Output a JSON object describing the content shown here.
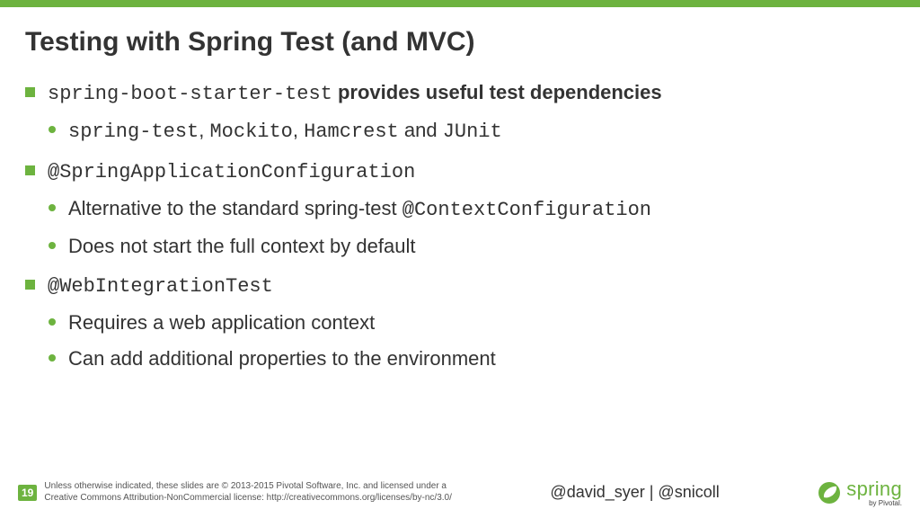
{
  "title": "Testing with Spring Test (and MVC)",
  "bullets": [
    {
      "line_parts": [
        {
          "text": "spring-boot-starter-test",
          "mono": true,
          "bold": false
        },
        {
          "text": " provides useful test dependencies",
          "mono": false,
          "bold": true
        }
      ],
      "subs": [
        {
          "parts": [
            {
              "text": "spring-test",
              "mono": true
            },
            {
              "text": ", ",
              "mono": false
            },
            {
              "text": "Mockito",
              "mono": true
            },
            {
              "text": ", ",
              "mono": false
            },
            {
              "text": "Hamcrest",
              "mono": true
            },
            {
              "text": " and ",
              "mono": false
            },
            {
              "text": "JUnit",
              "mono": true
            }
          ]
        }
      ]
    },
    {
      "line_parts": [
        {
          "text": "@SpringApplicationConfiguration",
          "mono": true,
          "bold": false
        }
      ],
      "subs": [
        {
          "parts": [
            {
              "text": "Alternative to the standard spring-test ",
              "mono": false
            },
            {
              "text": "@ContextConfiguration",
              "mono": true
            }
          ]
        },
        {
          "parts": [
            {
              "text": "Does not start the full context by default",
              "mono": false
            }
          ]
        }
      ]
    },
    {
      "line_parts": [
        {
          "text": " ",
          "mono": false,
          "bold": false
        },
        {
          "text": "@WebIntegrationTest",
          "mono": true,
          "bold": false
        }
      ],
      "subs": [
        {
          "parts": [
            {
              "text": "Requires a  web application context",
              "mono": false
            }
          ]
        },
        {
          "parts": [
            {
              "text": "Can add additional properties to the environment",
              "mono": false
            }
          ]
        }
      ]
    }
  ],
  "footer": {
    "page": "19",
    "license_line1": "Unless otherwise indicated, these slides are © 2013-2015 Pivotal Software, Inc. and licensed under a",
    "license_line2": "Creative Commons Attribution-NonCommercial license: http://creativecommons.org/licenses/by-nc/3.0/",
    "handles": "@david_syer | @snicoll",
    "logo_text": "spring",
    "logo_sub": "by Pivotal."
  }
}
